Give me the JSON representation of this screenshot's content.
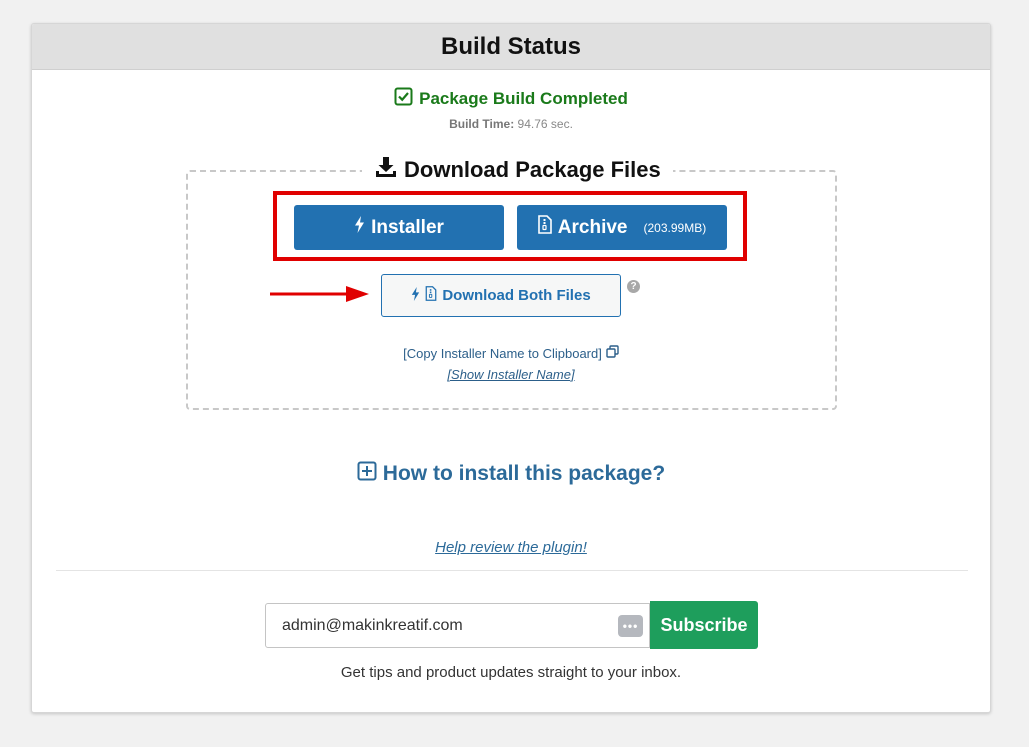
{
  "header": {
    "title": "Build Status"
  },
  "status": {
    "text": "Package Build Completed",
    "color": "#1a7a1a"
  },
  "build_time": {
    "label": "Build Time:",
    "value": "94.76 sec."
  },
  "download": {
    "legend": "Download Package Files",
    "installer_label": "Installer",
    "archive_label": "Archive",
    "archive_size": "(203.99MB)",
    "both_label": "Download Both Files",
    "help_char": "?"
  },
  "links": {
    "copy_installer": "[Copy Installer Name to Clipboard]",
    "show_installer": "[Show Installer Name]",
    "how_to": "How to install this package?",
    "review": "Help review the plugin!"
  },
  "subscribe": {
    "email_value": "admin@makinkreatif.com",
    "button_label": "Subscribe",
    "tips": "Get tips and product updates straight to your inbox."
  },
  "colors": {
    "primary": "#2271b1",
    "highlight_red": "#e00000",
    "subscribe_green": "#1e9e5c"
  }
}
